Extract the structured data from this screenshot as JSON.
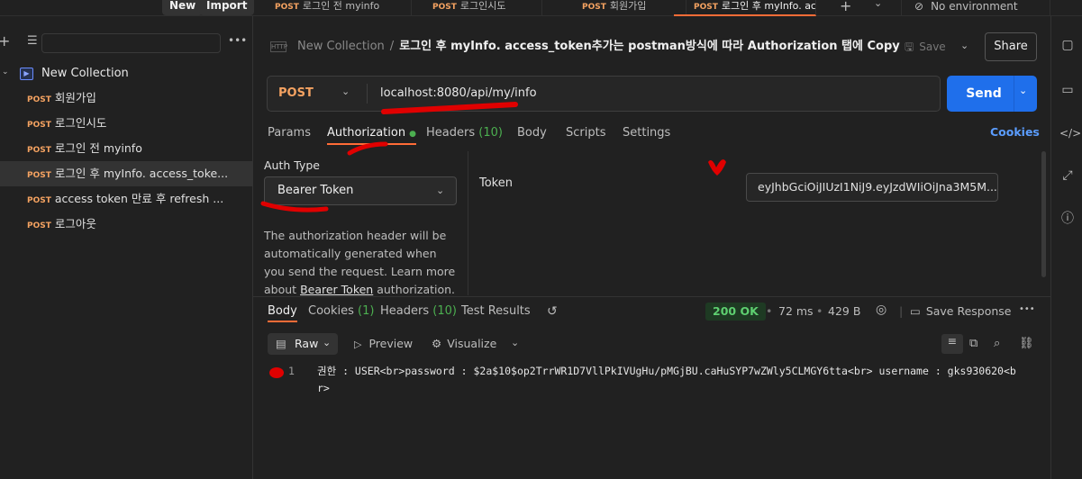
{
  "topbar": {
    "new_label": "New",
    "import_label": "Import",
    "tabs": [
      {
        "method": "POST",
        "name": "로그인 전 myinfo"
      },
      {
        "method": "POST",
        "name": "로그인시도"
      },
      {
        "method": "POST",
        "name": "회원가입"
      },
      {
        "method": "POST",
        "name": "로그인 후 myInfo. acc"
      }
    ],
    "environment": "No environment"
  },
  "sidebar": {
    "collection": "New Collection",
    "items": [
      {
        "method": "POST",
        "name": "회원가입"
      },
      {
        "method": "POST",
        "name": "로그인시도"
      },
      {
        "method": "POST",
        "name": "로그인 전 myinfo"
      },
      {
        "method": "POST",
        "name": "로그인 후 myInfo. access_toke..."
      },
      {
        "method": "POST",
        "name": "access token 만료 후 refresh ..."
      },
      {
        "method": "POST",
        "name": "로그아웃"
      }
    ]
  },
  "header": {
    "http_badge": "HTTP",
    "collection": "New Collection",
    "separator": "/",
    "title": "로그인 후 myInfo. access_token추가는 postman방식에 따라 Authorization 탭에 Copy",
    "save_label": "Save",
    "share_label": "Share"
  },
  "request": {
    "method": "POST",
    "url": "localhost:8080/api/my/info",
    "send_label": "Send"
  },
  "request_tabs": {
    "params": "Params",
    "authorization": "Authorization",
    "headers": "Headers",
    "headers_count": "(10)",
    "body": "Body",
    "scripts": "Scripts",
    "settings": "Settings",
    "cookies": "Cookies"
  },
  "auth": {
    "type_label": "Auth Type",
    "type_value": "Bearer Token",
    "help_text": "The authorization header will be automatically generated when you send the request. Learn more about",
    "help_link": "Bearer Token",
    "help_tail": "authorization.",
    "token_label": "Token",
    "token_value": "eyJhbGciOiJIUzI1NiJ9.eyJzdWIiOiJna3M5M..."
  },
  "response": {
    "tabs": {
      "body": "Body",
      "cookies": "Cookies",
      "cookies_count": "(1)",
      "headers": "Headers",
      "headers_count": "(10)",
      "test_results": "Test Results"
    },
    "status": "200 OK",
    "time": "72 ms",
    "size": "429 B",
    "save_response": "Save Response",
    "raw_label": "Raw",
    "preview_label": "Preview",
    "visualize_label": "Visualize",
    "line_number": "1",
    "body_text": "권한 : USER<br>password : $2a$10$op2TrrWR1D7VllPkIVUgHu/pMGjBU.caHuSYP7wZWly5CLMGY6tta<br> username : gks930620<br>"
  },
  "colors": {
    "accent": "#ff6c37",
    "send": "#1f6feb",
    "method": "#f4a261",
    "link": "#5b9dff",
    "status_ok": "#5ecf70",
    "annotation": "#e00000"
  }
}
